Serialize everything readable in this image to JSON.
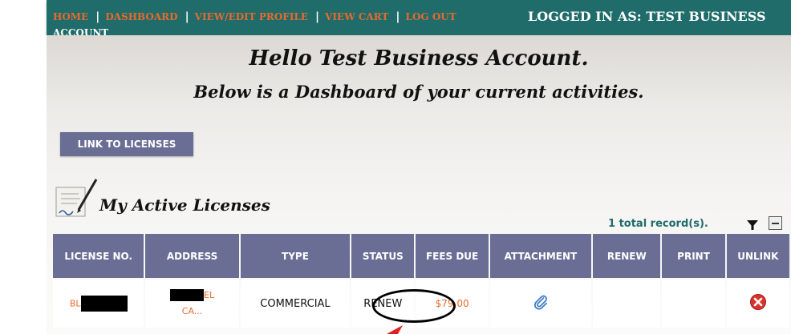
{
  "nav": {
    "home": "HOME",
    "dashboard": "DASHBOARD",
    "profile": "VIEW/EDIT PROFILE",
    "cart": "VIEW CART",
    "logout": "LOG OUT",
    "separator": "|",
    "logged_in_label": "LOGGED IN AS:  TEST BUSINESS",
    "logged_in_overflow": "ACCOUNT"
  },
  "greeting": {
    "title": "Hello Test Business Account.",
    "subtitle": "Below is a Dashboard of your current activities."
  },
  "link_button": "LINK TO LICENSES",
  "licenses": {
    "section_title": "My Active Licenses",
    "total_records": "1 total record(s).",
    "columns": [
      "LICENSE NO.",
      "ADDRESS",
      "TYPE",
      "STATUS",
      "FEES DUE",
      "ATTACHMENT",
      "RENEW",
      "PRINT",
      "UNLINK"
    ],
    "rows": [
      {
        "license_prefix": "BL",
        "address_line1_suffix": "EL",
        "address_line2": "CA...",
        "type": "COMMERCIAL",
        "status": "RENEW",
        "fees_due": "$79.00"
      }
    ]
  },
  "colors": {
    "topbar": "#1f6c6a",
    "nav_link": "#e86a2c",
    "header_fill": "#6a6e95",
    "total_text": "#1f6c6a",
    "unlink_red": "#d9342b",
    "attachment_blue": "#3f7fc7"
  },
  "icons": {
    "filter": "funnel-icon",
    "collapse": "minus-icon",
    "attachment": "paperclip-icon",
    "unlink": "red-x-icon",
    "license": "document-pen-icon"
  }
}
